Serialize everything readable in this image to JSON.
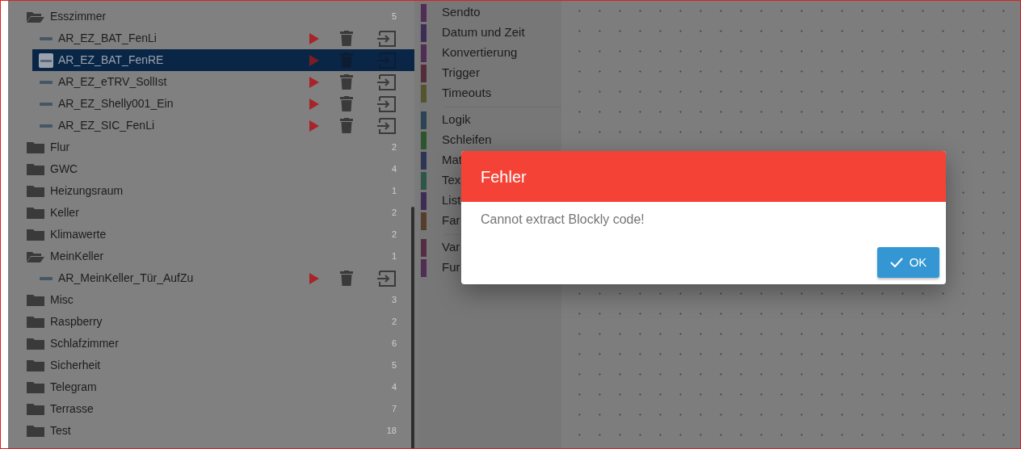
{
  "tree": [
    {
      "name": "Esszimmer",
      "count": "5",
      "expanded": true,
      "children": [
        {
          "name": "AR_EZ_BAT_FenLi",
          "selected": false
        },
        {
          "name": "AR_EZ_BAT_FenRE",
          "selected": true
        },
        {
          "name": "AR_EZ_eTRV_SollIst",
          "selected": false
        },
        {
          "name": "AR_EZ_Shelly001_Ein",
          "selected": false
        },
        {
          "name": "AR_EZ_SIC_FenLi",
          "selected": false
        }
      ]
    },
    {
      "name": "Flur",
      "count": "2",
      "expanded": false
    },
    {
      "name": "GWC",
      "count": "4",
      "expanded": false
    },
    {
      "name": "Heizungsraum",
      "count": "1",
      "expanded": false
    },
    {
      "name": "Keller",
      "count": "2",
      "expanded": false
    },
    {
      "name": "Klimawerte",
      "count": "2",
      "expanded": false
    },
    {
      "name": "MeinKeller",
      "count": "1",
      "expanded": true,
      "children": [
        {
          "name": "AR_MeinKeller_Tür_AufZu",
          "selected": false
        }
      ]
    },
    {
      "name": "Misc",
      "count": "3",
      "expanded": false
    },
    {
      "name": "Raspberry",
      "count": "2",
      "expanded": false
    },
    {
      "name": "Schlafzimmer",
      "count": "6",
      "expanded": false
    },
    {
      "name": "Sicherheit",
      "count": "5",
      "expanded": false
    },
    {
      "name": "Telegram",
      "count": "4",
      "expanded": false
    },
    {
      "name": "Terrasse",
      "count": "7",
      "expanded": false
    },
    {
      "name": "Test",
      "count": "18",
      "expanded": false
    }
  ],
  "toolbox": [
    {
      "label": "Sendto",
      "color": "#4f2d55"
    },
    {
      "label": "Datum und Zeit",
      "color": "#3d2d55"
    },
    {
      "label": "Konvertierung",
      "color": "#4f2d55"
    },
    {
      "label": "Trigger",
      "color": "#552d3a"
    },
    {
      "label": "Timeouts",
      "color": "#55552d",
      "group_end": true
    },
    {
      "label": "Logik",
      "color": "#2d4255"
    },
    {
      "label": "Schleifen",
      "color": "#2d552d"
    },
    {
      "label": "Mat",
      "color": "#2d3555"
    },
    {
      "label": "Tex",
      "color": "#2d5548"
    },
    {
      "label": "List",
      "color": "#3d2d55"
    },
    {
      "label": "Far",
      "color": "#553d2d",
      "group_end": true
    },
    {
      "label": "Var",
      "color": "#552d42"
    },
    {
      "label": "Fur",
      "color": "#4f2d55"
    }
  ],
  "dialog": {
    "title": "Fehler",
    "message": "Cannot extract Blockly code!",
    "ok_button": "OK"
  }
}
